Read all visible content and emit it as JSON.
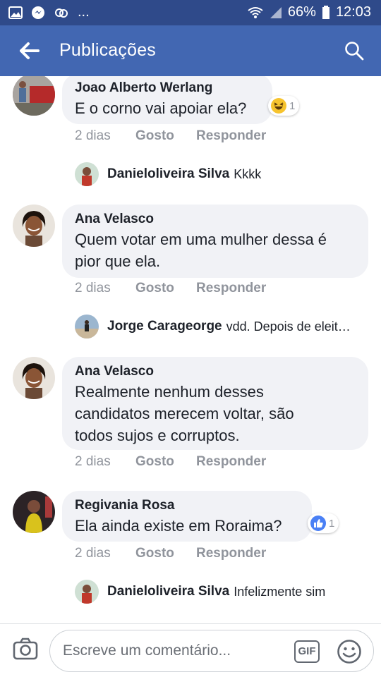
{
  "status": {
    "battery": "66%",
    "time": "12:03",
    "more": "..."
  },
  "header": {
    "title": "Publicações"
  },
  "comments": [
    {
      "author": "Joao Alberto Werlang",
      "text": "E o corno vai apoiar ela?",
      "time": "2 dias",
      "like": "Gosto",
      "reply": "Responder",
      "reaction": {
        "icon": "haha-icon",
        "count": "1"
      },
      "replies": [
        {
          "author": "Danieloliveira Silva",
          "text": "Kkkk"
        }
      ]
    },
    {
      "author": "Ana Velasco",
      "text_lines": [
        "Quem votar em uma mulher dessa é",
        "pior que ela."
      ],
      "time": "2 dias",
      "like": "Gosto",
      "reply": "Responder",
      "replies": [
        {
          "author": "Jorge Carageorge",
          "text": "vdd. Depois de eleit…"
        }
      ]
    },
    {
      "author": "Ana Velasco",
      "text_lines": [
        "Realmente nenhum desses",
        "candidatos merecem voltar, são",
        "todos sujos e corruptos."
      ],
      "time": "2 dias",
      "like": "Gosto",
      "reply": "Responder"
    },
    {
      "author": "Regivania Rosa",
      "text": "Ela ainda existe em Roraima?",
      "time": "2 dias",
      "like": "Gosto",
      "reply": "Responder",
      "reaction": {
        "icon": "like-icon",
        "count": "1"
      },
      "replies": [
        {
          "author": "Danieloliveira Silva",
          "text": "Infelizmente sim"
        }
      ]
    }
  ],
  "composer": {
    "placeholder": "Escreve um comentário...",
    "gif_label": "GIF"
  },
  "colors": {
    "header_bg": "#4267b2",
    "statusbar_bg": "#2f4a8a",
    "bubble_bg": "#f1f2f6",
    "like_blue": "#4a80f5"
  }
}
